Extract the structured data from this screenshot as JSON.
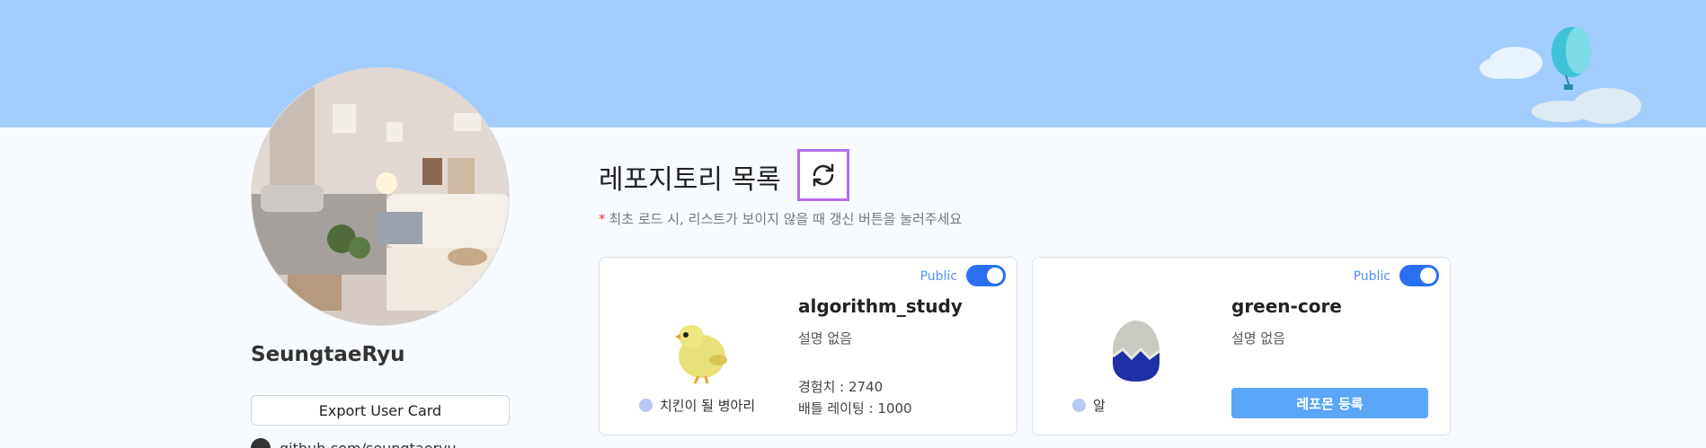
{
  "profile": {
    "username": "SeungtaeRyu",
    "export_label": "Export User Card",
    "github_text": "github.com/seungtaeryu"
  },
  "repos_section": {
    "title": "레포지토리 목록",
    "notice": "최초 로드 시, 리스트가 보이지 않을 때 갱신 버튼을 눌러주세요",
    "notice_star": "*"
  },
  "repos": [
    {
      "visibility": "Public",
      "name": "algorithm_study",
      "description": "설명 없음",
      "stage": "치킨이 될 병아리",
      "exp": "경험치 : 2740",
      "rating": "배틀 레이팅 : 1000",
      "pet_icon": "chick-icon"
    },
    {
      "visibility": "Public",
      "name": "green-core",
      "description": "설명 없음",
      "stage": "알",
      "register_label": "레포몬 등록",
      "pet_icon": "egg-icon"
    }
  ],
  "colors": {
    "banner": "#a3cdfc",
    "accent": "#2a6ff0",
    "refresh_border": "#b56ce9",
    "register_btn": "#5aa6f8"
  }
}
